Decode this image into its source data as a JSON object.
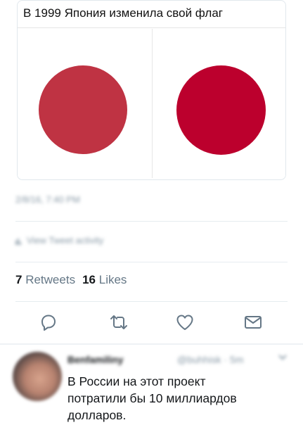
{
  "card": {
    "title": "В 1999 Япония изменила свой флаг",
    "flags": [
      {
        "name": "old",
        "sun_color": "#bf3343"
      },
      {
        "name": "new",
        "sun_color": "#bc002d"
      }
    ]
  },
  "tweet": {
    "timestamp": "2/8/16, 7:40 PM",
    "activity_label": "View Tweet activity",
    "stats": {
      "retweets_count": "7",
      "retweets_label": "Retweets",
      "likes_count": "16",
      "likes_label": "Likes"
    },
    "actions": {
      "reply_icon": "reply-icon",
      "retweet_icon": "retweet-icon",
      "like_icon": "heart-icon",
      "dm_icon": "envelope-icon"
    }
  },
  "reply": {
    "name": "Benfamiliny",
    "handle": "@buhhisk · 5m",
    "text": "В России на этот проект\nпотратили бы 10 миллиардов\nдолларов."
  },
  "colors": {
    "icon": "#657786",
    "muted": "#8899a6",
    "text": "#14171a"
  }
}
